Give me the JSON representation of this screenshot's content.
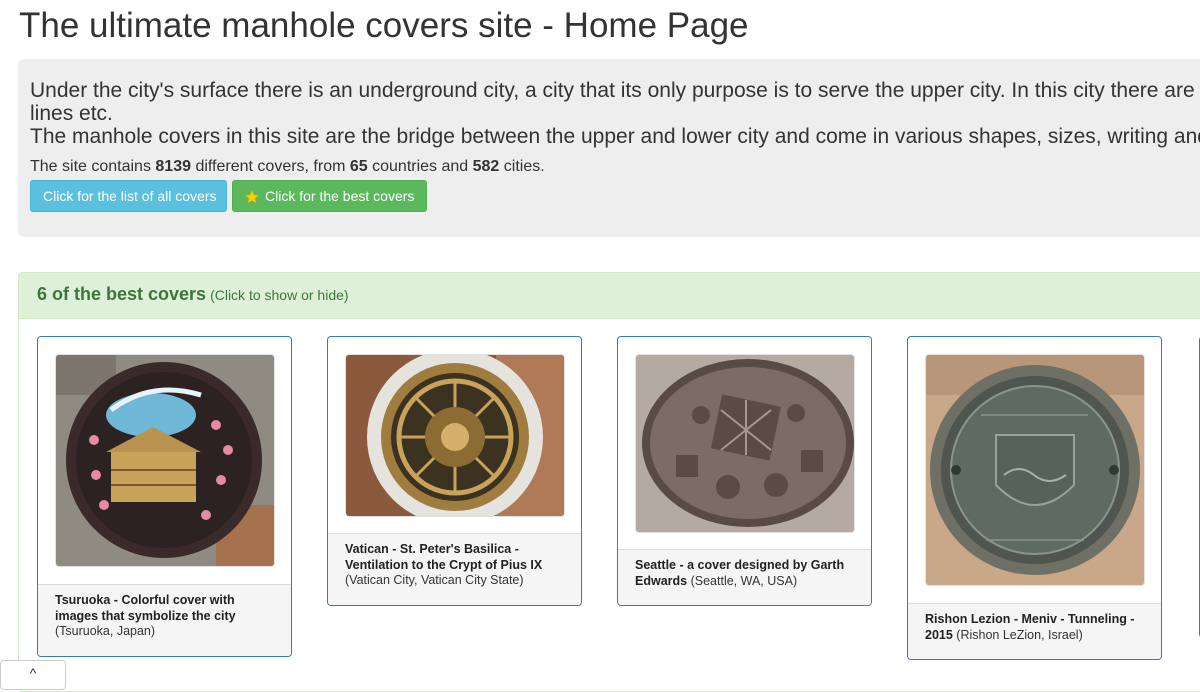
{
  "page": {
    "title": "The ultimate manhole covers site - Home Page"
  },
  "jumbotron": {
    "line1": "Under the city's surface there is an underground city, a city that its only purpose is to serve the upper city. In this city there are sewage pipes, electricity lines, communication",
    "line2": "lines etc.",
    "line3": "The manhole covers in this site are the bridge between the upper and lower city and come in various shapes, sizes, writing and decorations.",
    "stats": {
      "prefix": "The site contains ",
      "covers": "8139",
      "mid1": " different covers, from ",
      "countries": "65",
      "mid2": " countries and ",
      "cities": "582",
      "suffix": " cities."
    },
    "buttons": {
      "all_label": "Click for the list of all covers",
      "best_label": "Click for the best covers"
    }
  },
  "best_panel": {
    "title": "6 of the best covers",
    "hint": "(Click to show or hide)",
    "cards": [
      {
        "title": "Tsuruoka - Colorful cover with images that symbolize the city",
        "place": "(Tsuruoka, Japan)"
      },
      {
        "title": "Vatican - St. Peter's Basilica - Ventilation to the Crypt of Pius IX",
        "place": "(Vatican City, Vatican City State)"
      },
      {
        "title": "Seattle - a cover designed by Garth Edwards",
        "place": "(Seattle, WA, USA)"
      },
      {
        "title": "Rishon Lezion - Meniv - Tunneling - 2015",
        "place": "(Rishon LeZion, Israel)"
      }
    ]
  },
  "scroll_tab": {
    "label": "^"
  },
  "colors": {
    "info_button": "#5bc0de",
    "success_button": "#5cb85c",
    "panel_heading": "#dff0d8",
    "panel_text": "#3c763d",
    "card_border": "#337ab7"
  },
  "icons": {
    "best_button_icon": "star-icon"
  }
}
